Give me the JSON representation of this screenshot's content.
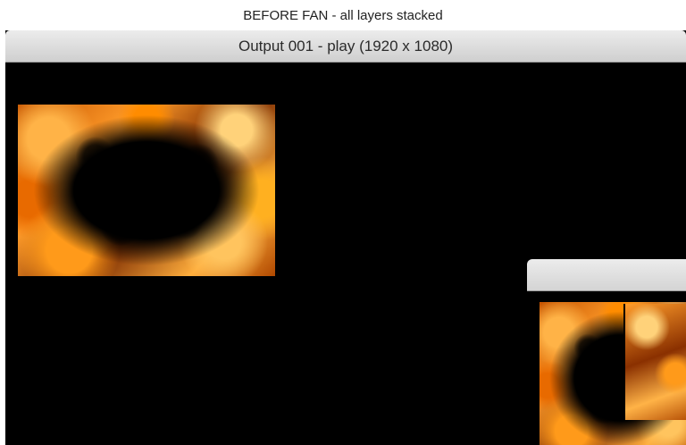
{
  "caption": "BEFORE FAN - all layers stacked",
  "main_window": {
    "title": "Output 001 - play (1920 x 1080)"
  },
  "second_window": {
    "title": ""
  },
  "colors": {
    "titlebar": "#d9d9d9",
    "background": "#000000",
    "fire_orange": "#ff9c2a"
  }
}
